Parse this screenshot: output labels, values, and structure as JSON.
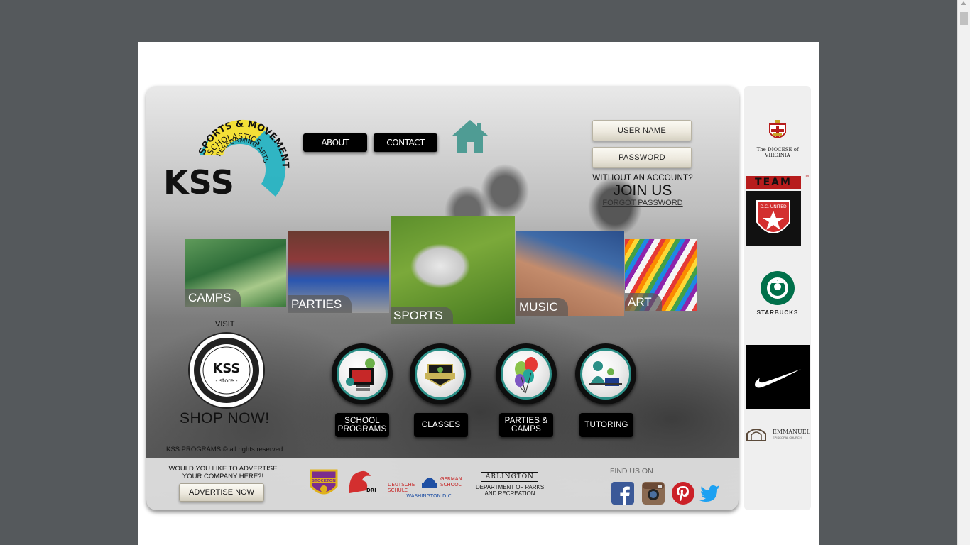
{
  "nav": {
    "about_label": "ABOUT",
    "contact_label": "CONTACT"
  },
  "login": {
    "username_label": "USER NAME",
    "password_label": "PASSWORD",
    "no_account_text": "WITHOUT AN ACCOUNT?",
    "join_label": "JOIN US",
    "forgot_label": "FORGOT PASSWORD"
  },
  "logo": {
    "letters": "KSS",
    "arc_outer": "SPORTS & MOVEMENT",
    "arc_mid": "SCHOLASTICS",
    "arc_inner": "PERFORMING ARTS"
  },
  "tiles": [
    {
      "label": "CAMPS"
    },
    {
      "label": "PARTIES"
    },
    {
      "label": "SPORTS"
    },
    {
      "label": "MUSIC"
    },
    {
      "label": "ART"
    }
  ],
  "store": {
    "visit_text": "VISIT",
    "badge_text": "KSS",
    "badge_sub": "- store -",
    "shop_label": "SHOP NOW!"
  },
  "services": [
    {
      "label_line1": "SCHOOL",
      "label_line2": "PROGRAMS",
      "icon": "school-programs-icon"
    },
    {
      "label_line1": "CLASSES",
      "label_line2": "",
      "icon": "classes-icon"
    },
    {
      "label_line1": "PARTIES &",
      "label_line2": "CAMPS",
      "icon": "balloons-icon"
    },
    {
      "label_line1": "TUTORING",
      "label_line2": "",
      "icon": "tutoring-icon"
    }
  ],
  "footer": {
    "copyright": "KSS PROGRAMS © all rights reserved.",
    "advertise_question_1": "WOULD YOU LIKE TO ADVERTISE",
    "advertise_question_2": "YOUR COMPANY HERE?!",
    "advertise_button": "ADVERTISE NOW",
    "find_us": "FIND US ON",
    "partner_parks_1": "DEPARTMENT OF PARKS",
    "partner_parks_2": "AND RECREATION",
    "partner_arlington": "ARLINGTON",
    "partner_deutsche_1": "DEUTSCHE",
    "partner_deutsche_2": "SCHULE",
    "partner_german_1": "GERMAN",
    "partner_german_2": "SCHOOL",
    "partner_washington": "WASHINGTON D.C.",
    "partner_stockton_1": "STOCKTON",
    "partner_drew": "DREW"
  },
  "sponsors": {
    "diocese": "The DIOCESE of VIRGINIA",
    "team": "TEAM",
    "dc_united": "D.C. UNITED",
    "starbucks": "STARBUCKS",
    "emmanuel_1": "EMMANUEL",
    "emmanuel_2": "EPISCOPAL CHURCH"
  },
  "colors": {
    "background": "#55595c",
    "accent_teal": "#4f9c94",
    "facebook": "#3b5998",
    "pinterest": "#cb2027",
    "twitter": "#1da1f2"
  }
}
